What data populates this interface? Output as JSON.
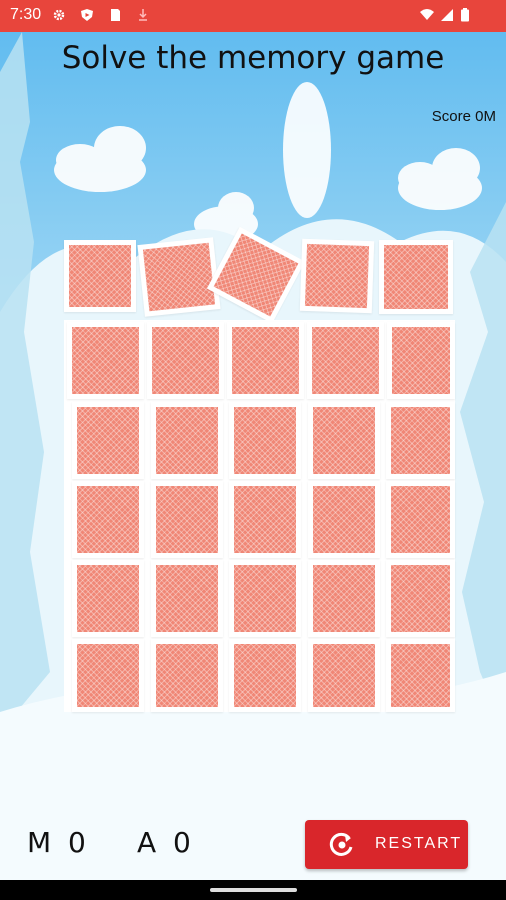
{
  "status": {
    "time": "7:30"
  },
  "title": "Solve the memory game",
  "score_text": "Score 0M",
  "board": {
    "rows": 6,
    "cols": 5,
    "face_down_cards": 30
  },
  "counters": {
    "moves": "M 0",
    "attempts": "A 0"
  },
  "restart": {
    "label": "RESTART",
    "icon": "restart-icon"
  },
  "colors": {
    "card": "#f08776",
    "button": "#d9262b",
    "statusbar": "#e8453c"
  }
}
